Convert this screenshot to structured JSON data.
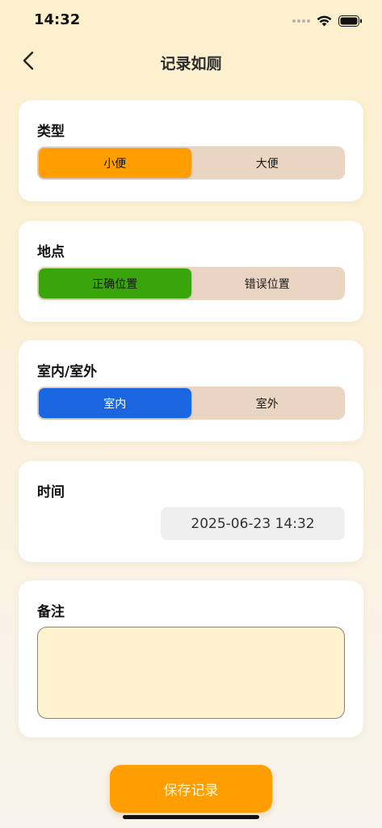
{
  "status_bar": {
    "time": "14:32"
  },
  "nav": {
    "title": "记录如厕"
  },
  "type_card": {
    "label": "类型",
    "options": [
      "小便",
      "大便"
    ],
    "selected_index": 0,
    "selected_color": "#ff9e00"
  },
  "location_card": {
    "label": "地点",
    "options": [
      "正确位置",
      "错误位置"
    ],
    "selected_index": 0,
    "selected_color": "#3aa50b"
  },
  "indoor_card": {
    "label": "室内/室外",
    "options": [
      "室内",
      "室外"
    ],
    "selected_index": 0,
    "selected_color": "#1a66e0"
  },
  "time_card": {
    "label": "时间",
    "value": "2025-06-23 14:32"
  },
  "notes_card": {
    "label": "备注",
    "value": ""
  },
  "save_button": {
    "label": "保存记录",
    "color": "#ff9e00"
  },
  "colors": {
    "segment_bg": "#ead5c3",
    "notes_bg": "#fff2cf"
  }
}
